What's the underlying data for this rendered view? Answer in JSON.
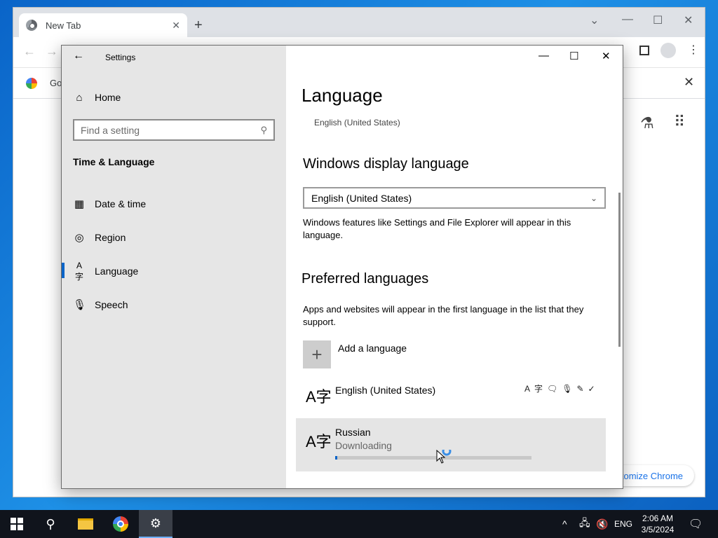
{
  "chrome": {
    "tab_title": "New Tab",
    "tab_close": "✕",
    "new_tab": "+",
    "bookmark_partial": "Go",
    "customize_label": "tomize Chrome"
  },
  "settings": {
    "window_title": "Settings",
    "sidebar": {
      "home": "Home",
      "search_placeholder": "Find a setting",
      "section": "Time & Language",
      "items": [
        {
          "label": "Date & time",
          "icon": "calendar-clock-icon"
        },
        {
          "label": "Region",
          "icon": "globe-icon"
        },
        {
          "label": "Language",
          "icon": "language-icon"
        },
        {
          "label": "Speech",
          "icon": "microphone-icon"
        }
      ]
    },
    "page": {
      "title": "Language",
      "current_language": "English (United States)",
      "display_language_heading": "Windows display language",
      "display_language_value": "English (United States)",
      "display_language_desc": "Windows features like Settings and File Explorer will appear in this language.",
      "preferred_heading": "Preferred languages",
      "preferred_desc": "Apps and websites will appear in the first language in the list that they support.",
      "add_language": "Add a language",
      "languages": [
        {
          "name": "English (United States)",
          "status": ""
        },
        {
          "name": "Russian",
          "status": "Downloading",
          "progress": 0.01
        }
      ]
    }
  },
  "taskbar": {
    "language": "ENG",
    "time": "2:06 AM",
    "date": "3/5/2024"
  }
}
